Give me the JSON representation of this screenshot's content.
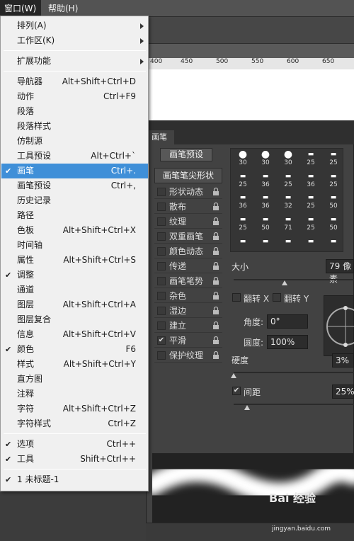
{
  "menubar": {
    "window": "窗口(W)",
    "help": "帮助(H)"
  },
  "ruler": {
    "ticks": [
      "400",
      "450",
      "500",
      "550",
      "600",
      "650"
    ]
  },
  "window_menu": {
    "groups": [
      {
        "items": [
          {
            "label": "排列(A)",
            "submenu": true
          },
          {
            "label": "工作区(K)",
            "submenu": true
          }
        ]
      },
      {
        "items": [
          {
            "label": "扩展功能",
            "submenu": true
          }
        ]
      },
      {
        "items": [
          {
            "label": "导航器",
            "shortcut": "Alt+Shift+Ctrl+D"
          },
          {
            "label": "动作",
            "shortcut": "Ctrl+F9"
          },
          {
            "label": "段落"
          },
          {
            "label": "段落样式"
          },
          {
            "label": "仿制源"
          },
          {
            "label": "工具预设",
            "shortcut": "Alt+Ctrl+`"
          },
          {
            "label": "画笔",
            "shortcut": "Ctrl+.",
            "checked": true,
            "highlighted": true
          },
          {
            "label": "画笔预设",
            "shortcut": "Ctrl+,"
          },
          {
            "label": "历史记录"
          },
          {
            "label": "路径"
          },
          {
            "label": "色板",
            "shortcut": "Alt+Shift+Ctrl+X"
          },
          {
            "label": "时间轴"
          },
          {
            "label": "属性",
            "shortcut": "Alt+Shift+Ctrl+S"
          },
          {
            "label": "调整",
            "checked": true
          },
          {
            "label": "通道"
          },
          {
            "label": "图层",
            "shortcut": "Alt+Shift+Ctrl+A"
          },
          {
            "label": "图层复合"
          },
          {
            "label": "信息",
            "shortcut": "Alt+Shift+Ctrl+V"
          },
          {
            "label": "颜色",
            "shortcut": "F6",
            "checked": true
          },
          {
            "label": "样式",
            "shortcut": "Alt+Shift+Ctrl+Y"
          },
          {
            "label": "直方图"
          },
          {
            "label": "注释"
          },
          {
            "label": "字符",
            "shortcut": "Alt+Shift+Ctrl+Z"
          },
          {
            "label": "字符样式",
            "shortcut": "Ctrl+Z"
          }
        ]
      },
      {
        "items": [
          {
            "label": "选项",
            "shortcut": "Ctrl++",
            "checked": true
          },
          {
            "label": "工具",
            "shortcut": "Shift+Ctrl++",
            "checked": true
          }
        ]
      },
      {
        "items": [
          {
            "label": "1 未标题-1",
            "checked": true
          }
        ]
      }
    ]
  },
  "brush_panel": {
    "tab": "画笔",
    "preset_button": "画笔预设",
    "tip_shape": "画笔笔尖形状",
    "options": [
      {
        "label": "形状动态",
        "checked": false
      },
      {
        "label": "散布",
        "checked": false
      },
      {
        "label": "纹理",
        "checked": false
      },
      {
        "label": "双重画笔",
        "checked": false
      },
      {
        "label": "颜色动态",
        "checked": false
      },
      {
        "label": "传递",
        "checked": false
      },
      {
        "label": "画笔笔势",
        "checked": false
      },
      {
        "label": "杂色",
        "checked": false
      },
      {
        "label": "湿边",
        "checked": false
      },
      {
        "label": "建立",
        "checked": false
      },
      {
        "label": "平滑",
        "checked": true
      },
      {
        "label": "保护纹理",
        "checked": false
      }
    ],
    "tip_sizes": [
      "30",
      "30",
      "30",
      "25",
      "25",
      "25",
      "36",
      "25",
      "36",
      "25",
      "36",
      "36",
      "32",
      "25",
      "50",
      "25",
      "50",
      "71",
      "25",
      "50"
    ],
    "size_label": "大小",
    "size_value": "79 像素",
    "flip_x_label": "翻转 X",
    "flip_y_label": "翻转 Y",
    "angle_label": "角度:",
    "angle_value": "0°",
    "roundness_label": "圆度:",
    "roundness_value": "100%",
    "hardness_label": "硬度",
    "hardness_value": "3%",
    "spacing_label": "间距",
    "spacing_value": "25%",
    "spacing_checked": true
  },
  "watermark": {
    "text": "Bai 经验",
    "url": "jingyan.baidu.com"
  }
}
